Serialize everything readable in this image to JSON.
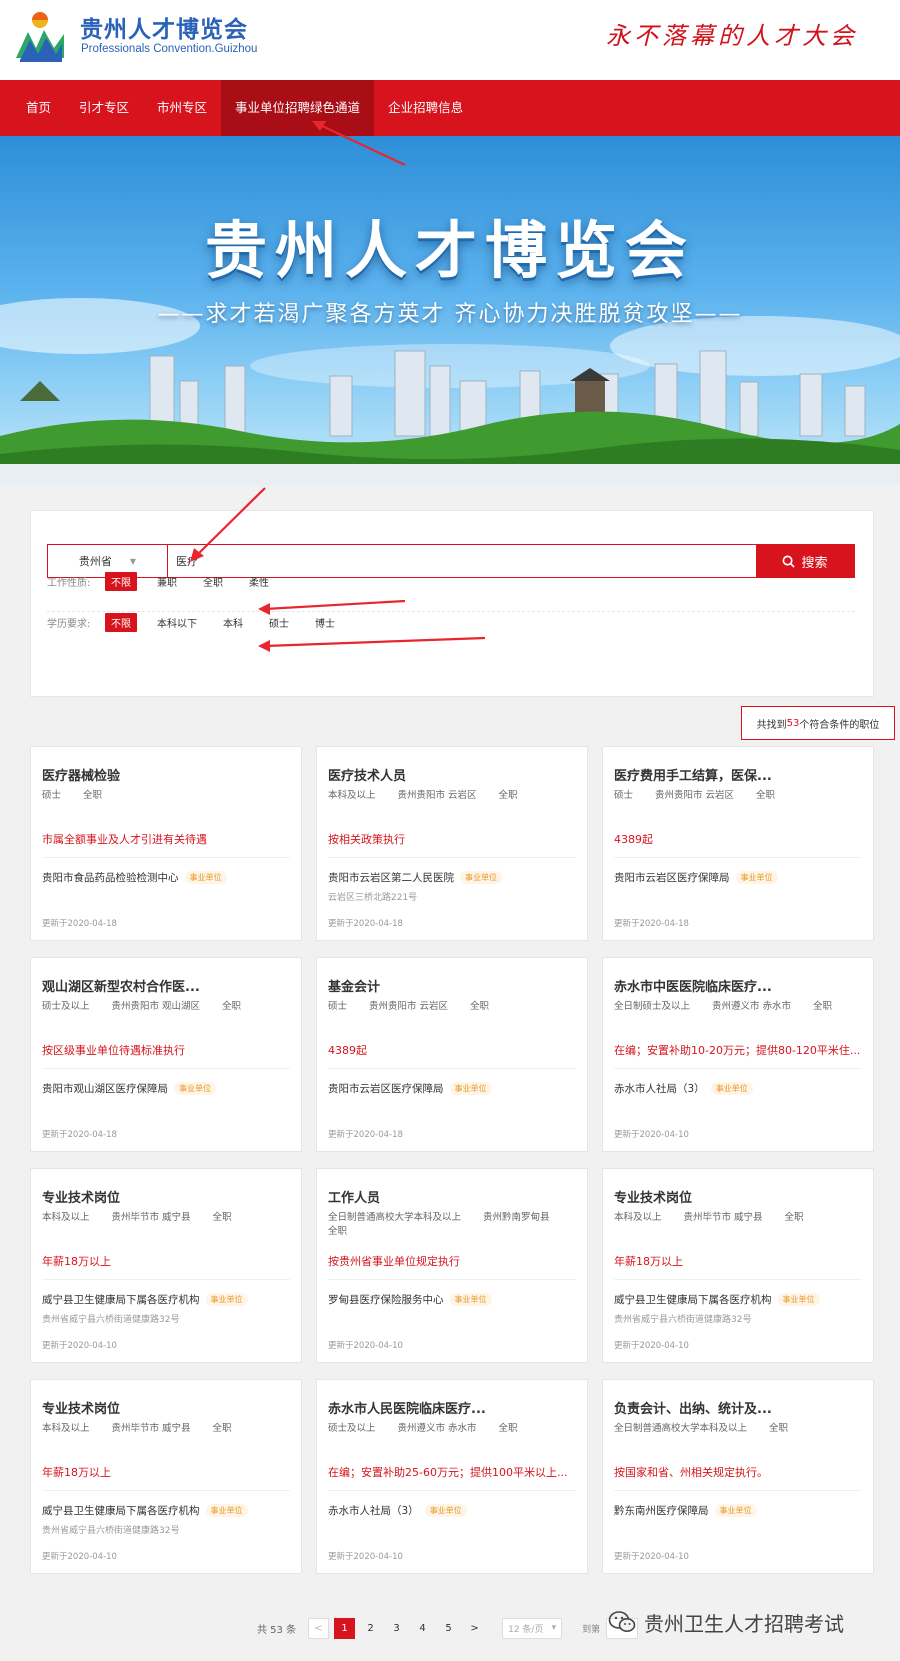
{
  "header": {
    "title": "贵州人才博览会",
    "subtitle": "Professionals Convention.Guizhou",
    "slogan": "永不落幕的人才大会"
  },
  "nav": {
    "items": [
      {
        "label": "首页"
      },
      {
        "label": "引才专区"
      },
      {
        "label": "市州专区"
      },
      {
        "label": "事业单位招聘绿色通道",
        "active": true
      },
      {
        "label": "企业招聘信息"
      }
    ]
  },
  "banner": {
    "title": "贵州人才博览会",
    "subtitle": "——求才若渴广聚各方英才   齐心协力决胜脱贫攻坚——"
  },
  "search": {
    "province": "贵州省",
    "query": "医疗",
    "button_label": "搜索",
    "work_type": {
      "label": "工作性质:",
      "options": [
        "不限",
        "兼职",
        "全职",
        "柔性"
      ],
      "selected": "不限"
    },
    "education": {
      "label": "学历要求:",
      "options": [
        "不限",
        "本科以下",
        "本科",
        "硕士",
        "博士"
      ],
      "selected": "不限"
    }
  },
  "results": {
    "prefix": "共找到",
    "count": "53",
    "suffix": "个符合条件的职位"
  },
  "jobs": [
    {
      "title": "医疗器械检验",
      "meta": [
        "硕士",
        "全职"
      ],
      "salary": "市属全额事业及人才引进有关待遇",
      "org": "贵阳市食品药品检验检测中心",
      "badge": "事业单位",
      "addr": "",
      "date": "更新于2020-04-18"
    },
    {
      "title": "医疗技术人员",
      "meta": [
        "本科及以上",
        "贵州贵阳市 云岩区",
        "全职"
      ],
      "salary": "按相关政策执行",
      "org": "贵阳市云岩区第二人民医院",
      "badge": "事业单位",
      "addr": "云岩区三桥北路221号",
      "date": "更新于2020-04-18"
    },
    {
      "title": "医疗费用手工结算，医保...",
      "meta": [
        "硕士",
        "贵州贵阳市 云岩区",
        "全职"
      ],
      "salary": "4389起",
      "org": "贵阳市云岩区医疗保障局",
      "badge": "事业单位",
      "addr": "",
      "date": "更新于2020-04-18"
    },
    {
      "title": "观山湖区新型农村合作医...",
      "meta": [
        "硕士及以上",
        "贵州贵阳市 观山湖区",
        "全职"
      ],
      "salary": "按区级事业单位待遇标准执行",
      "org": "贵阳市观山湖区医疗保障局",
      "badge": "事业单位",
      "addr": "",
      "date": "更新于2020-04-18"
    },
    {
      "title": "基金会计",
      "meta": [
        "硕士",
        "贵州贵阳市 云岩区",
        "全职"
      ],
      "salary": "4389起",
      "org": "贵阳市云岩区医疗保障局",
      "badge": "事业单位",
      "addr": "",
      "date": "更新于2020-04-18"
    },
    {
      "title": "赤水市中医医院临床医疗...",
      "meta": [
        "全日制硕士及以上",
        "贵州遵义市 赤水市",
        "全职"
      ],
      "salary": "在编；安置补助10-20万元；提供80-120平米住...",
      "org": "赤水市人社局（3）",
      "badge": "事业单位",
      "addr": "",
      "date": "更新于2020-04-10"
    },
    {
      "title": "专业技术岗位",
      "meta": [
        "本科及以上",
        "贵州毕节市 威宁县",
        "全职"
      ],
      "salary": "年薪18万以上",
      "org": "威宁县卫生健康局下属各医疗机构",
      "badge": "事业单位",
      "addr": "贵州省威宁县六桥街道健康路32号",
      "date": "更新于2020-04-10"
    },
    {
      "title": "工作人员",
      "meta": [
        "全日制普通高校大学本科及以上",
        "贵州黔南罗甸县",
        "全职"
      ],
      "salary": "按贵州省事业单位规定执行",
      "org": "罗甸县医疗保险服务中心",
      "badge": "事业单位",
      "addr": "",
      "date": "更新于2020-04-10"
    },
    {
      "title": "专业技术岗位",
      "meta": [
        "本科及以上",
        "贵州毕节市 威宁县",
        "全职"
      ],
      "salary": "年薪18万以上",
      "org": "威宁县卫生健康局下属各医疗机构",
      "badge": "事业单位",
      "addr": "贵州省威宁县六桥街道健康路32号",
      "date": "更新于2020-04-10"
    },
    {
      "title": "专业技术岗位",
      "meta": [
        "本科及以上",
        "贵州毕节市 威宁县",
        "全职"
      ],
      "salary": "年薪18万以上",
      "org": "威宁县卫生健康局下属各医疗机构",
      "badge": "事业单位",
      "addr": "贵州省威宁县六桥街道健康路32号",
      "date": "更新于2020-04-10"
    },
    {
      "title": "赤水市人民医院临床医疗...",
      "meta": [
        "硕士及以上",
        "贵州遵义市 赤水市",
        "全职"
      ],
      "salary": "在编；安置补助25-60万元；提供100平米以上...",
      "org": "赤水市人社局（3）",
      "badge": "事业单位",
      "addr": "",
      "date": "更新于2020-04-10"
    },
    {
      "title": "负责会计、出纳、统计及...",
      "meta": [
        "全日制普通高校大学本科及以上",
        "全职"
      ],
      "salary": "按国家和省、州相关规定执行。",
      "org": "黔东南州医疗保障局",
      "badge": "事业单位",
      "addr": "",
      "date": "更新于2020-04-10"
    }
  ],
  "pagination": {
    "total": "共 53 条",
    "prev": "<",
    "pages": [
      "1",
      "2",
      "3",
      "4",
      "5"
    ],
    "current": "1",
    "next": ">",
    "page_size": "12 条/页",
    "goto_label": "到第"
  },
  "watermark": "贵州卫生人才招聘考试",
  "colors": {
    "brand_red": "#d7141e",
    "brand_blue": "#2a62b8",
    "badge_orange": "#e89a2a"
  }
}
